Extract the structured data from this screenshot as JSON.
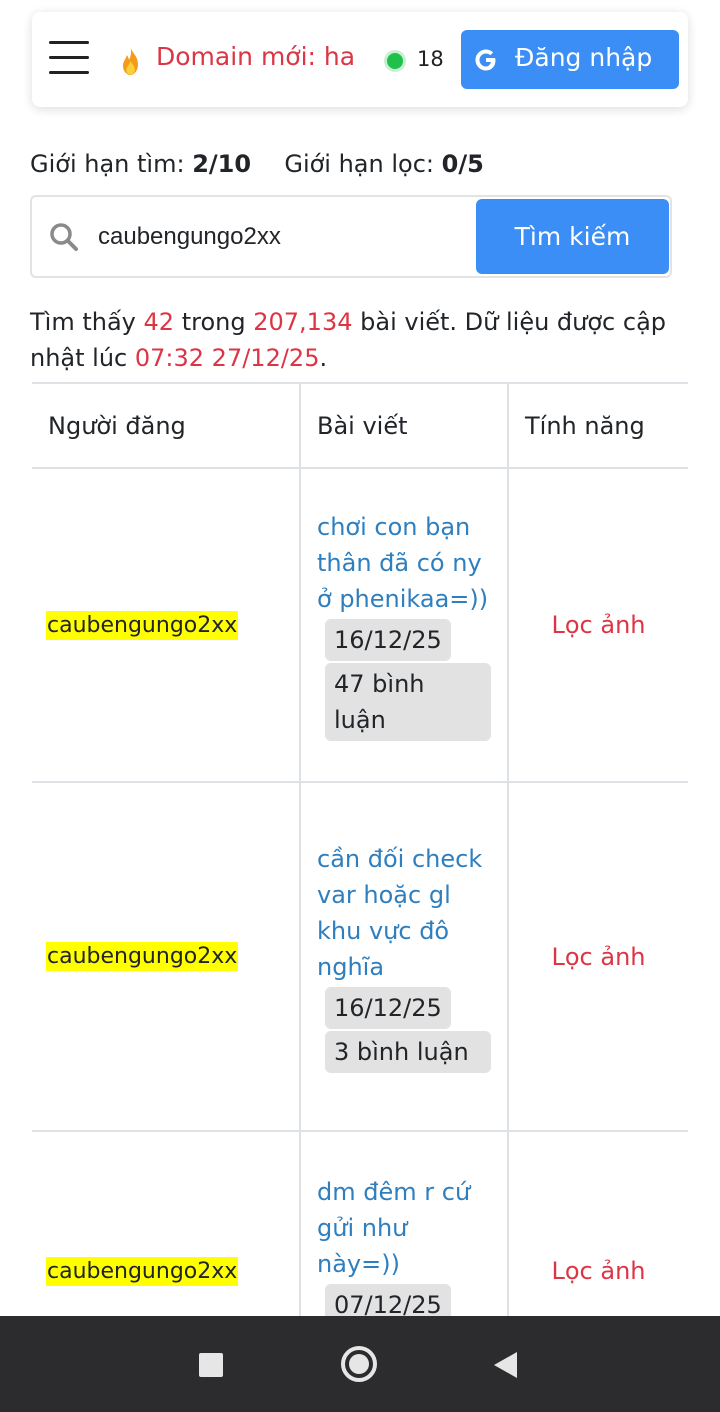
{
  "navbar": {
    "domain_label": "Domain mới: ha",
    "online_count": "18",
    "login_label": "Đăng nhập"
  },
  "limits": {
    "search_label": "Giới hạn tìm:",
    "search_value": "2/10",
    "filter_label": "Giới hạn lọc:",
    "filter_value": "0/5"
  },
  "search": {
    "query": "caubengungo2xx",
    "button_label": "Tìm kiếm"
  },
  "result_info": {
    "prefix": "Tìm thấy",
    "found": "42",
    "middle": "trong",
    "total": "207,134",
    "suffix": "bài viết. Dữ liệu được cập nhật lúc",
    "updated": "07:32 27/12/25",
    "end": "."
  },
  "table": {
    "headers": [
      "Người đăng",
      "Bài viết",
      "Tính năng"
    ],
    "rows": [
      {
        "user": "caubengungo2xx",
        "title": "chơi con bạn thân đã có ny ở phenikaa=))",
        "date": "16/12/25",
        "comments": "47 bình luận",
        "action": "Lọc ảnh"
      },
      {
        "user": "caubengungo2xx",
        "title": "cần đối check var hoặc gl khu vực đô nghĩa",
        "date": "16/12/25",
        "comments": "3 bình luận",
        "action": "Lọc ảnh"
      },
      {
        "user": "caubengungo2xx",
        "title": "dm đêm r cứ gửi như này=))",
        "date": "07/12/25",
        "comments": "",
        "action": "Lọc ảnh"
      }
    ]
  },
  "icons": {
    "menu": "hamburger-icon",
    "domain": "fire-icon",
    "status": "online-dot-icon",
    "login": "google-icon",
    "search": "search-icon",
    "nav_recents": "square-icon",
    "nav_home": "circle-icon",
    "nav_back": "back-triangle-icon"
  },
  "colors": {
    "accent": "#3b8ef5",
    "highlight_red": "#dc3545",
    "link_blue": "#2f7fbf",
    "user_highlight": "#ffff00",
    "online_green": "#20c04a"
  }
}
